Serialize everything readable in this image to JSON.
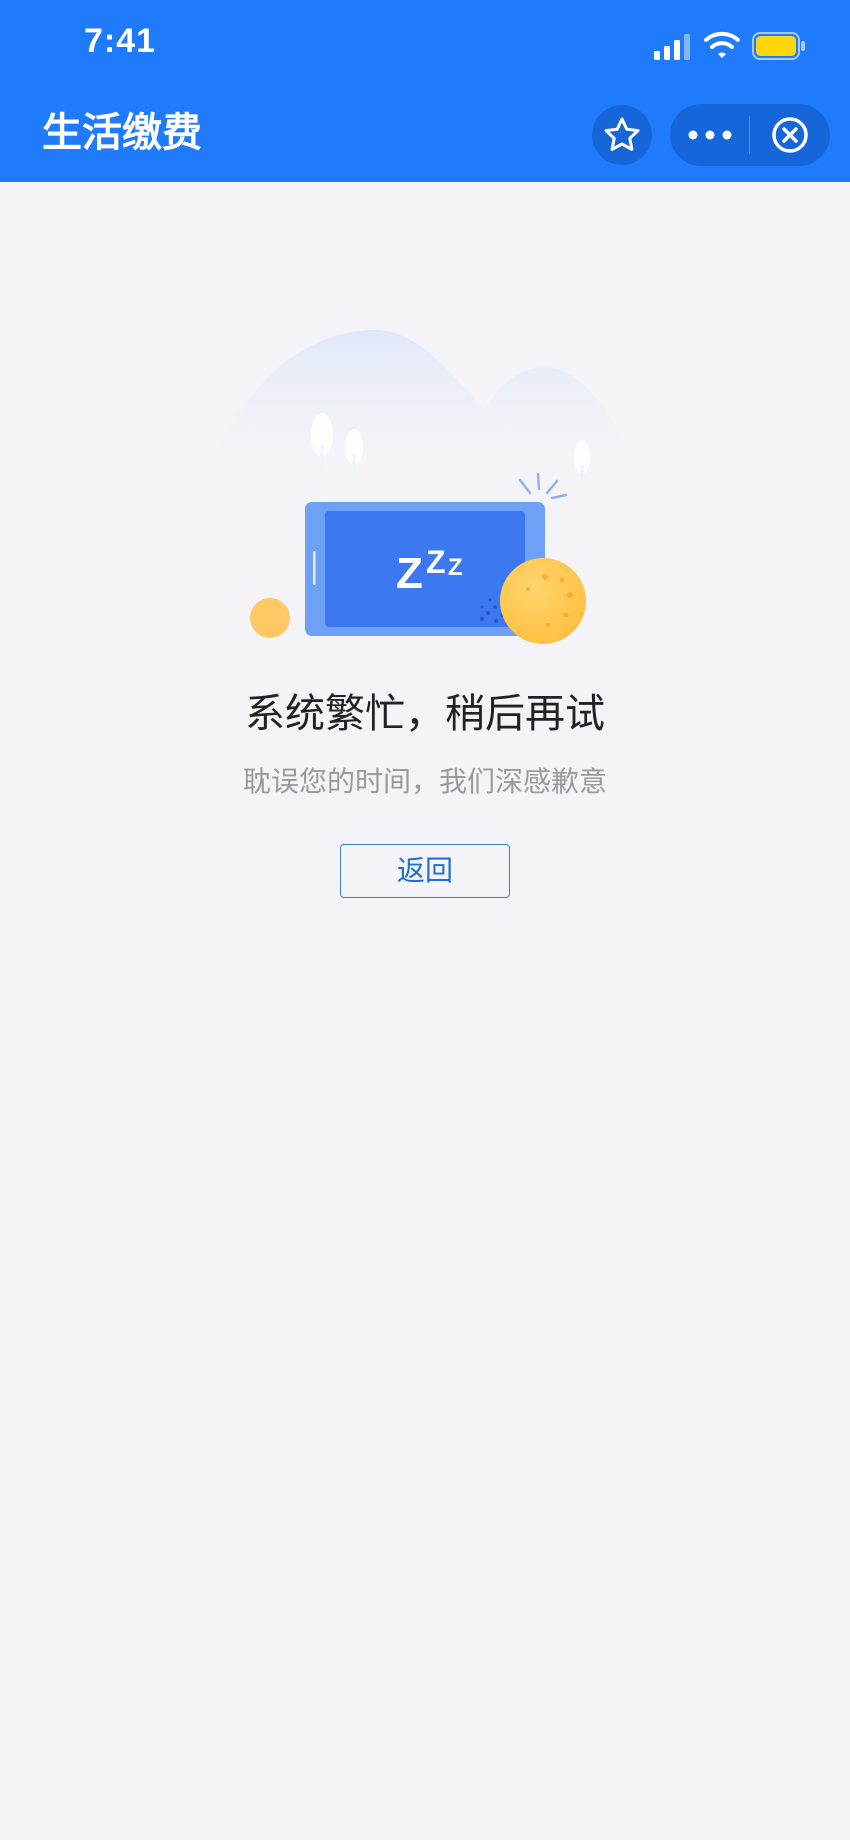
{
  "status_bar": {
    "time": "7:41",
    "icons": [
      "cellular-signal-icon",
      "wifi-icon",
      "battery-icon"
    ],
    "battery_color": "#ffd60a"
  },
  "nav_bar": {
    "title": "生活缴费",
    "background": "#1f7bfb",
    "buttons": [
      "star-icon",
      "more-icon",
      "close-icon"
    ]
  },
  "illustration": {
    "icons": [
      "mountains",
      "trees",
      "tablet",
      "sleep-zzz-icon",
      "moon-icon",
      "sparkle-icon"
    ],
    "sleep_text": "Z",
    "accent_color": "#3c78ef",
    "moon_color": "#ffc44d"
  },
  "error": {
    "title": "系统繁忙，稍后再试",
    "subtitle": "耽误您的时间，我们深感歉意",
    "back_button_label": "返回"
  }
}
